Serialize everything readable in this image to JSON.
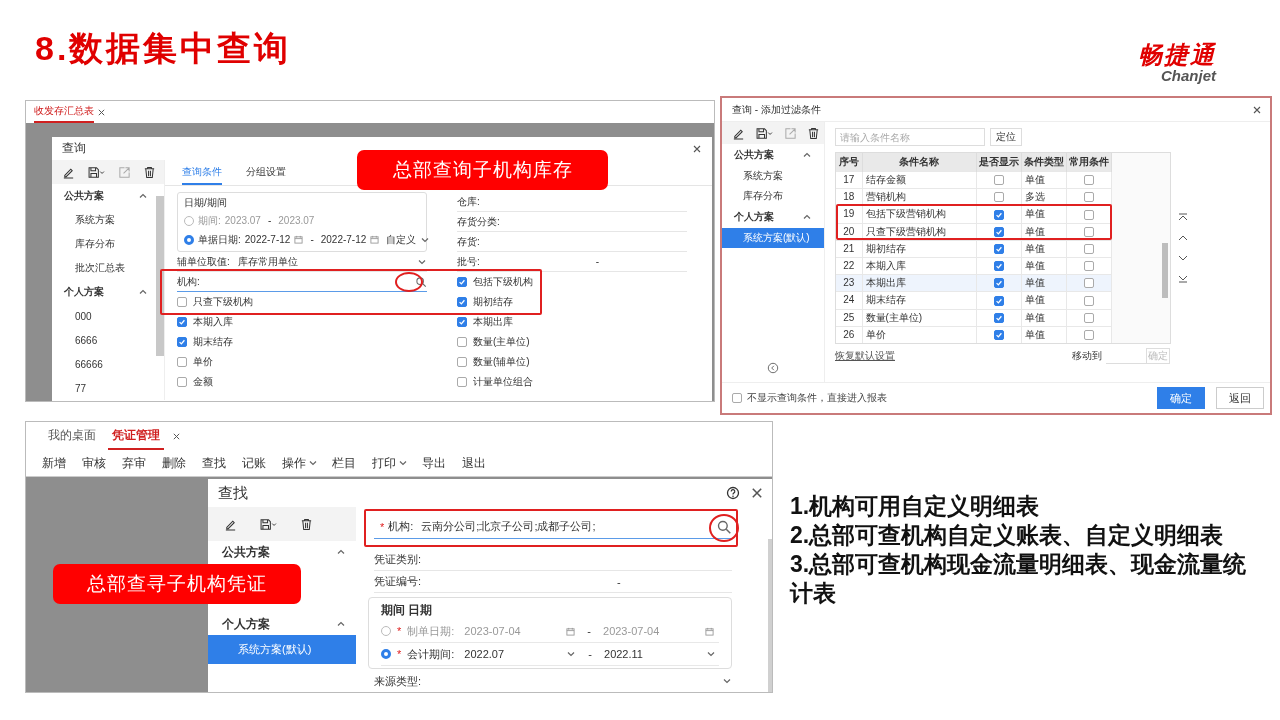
{
  "title": "8.数据集中查询",
  "logo": {
    "name": "畅捷通",
    "sub": "Chanjet"
  },
  "query_window": {
    "tabs": [
      {
        "label": "收发存汇总表",
        "selected": true
      }
    ],
    "dialog_title": "查询",
    "groups": [
      {
        "title": "公共方案",
        "expanded": true,
        "items": [
          {
            "label": "系统方案",
            "selected": false
          },
          {
            "label": "库存分布",
            "selected": false
          },
          {
            "label": "批次汇总表",
            "selected": false
          }
        ]
      },
      {
        "title": "个人方案",
        "expanded": true,
        "items": [
          {
            "label": "000",
            "selected": false
          },
          {
            "label": "6666",
            "selected": false
          },
          {
            "label": "66666",
            "selected": false
          },
          {
            "label": "77",
            "selected": false
          }
        ]
      }
    ],
    "dialog_tabs": [
      {
        "label": "查询条件",
        "selected": true
      },
      {
        "label": "分组设置",
        "selected": false
      }
    ],
    "date_box": {
      "title": "日期/期间",
      "rows": [
        {
          "label": "期间:",
          "from": "2023.07",
          "separator": "-",
          "to": "2023.07",
          "selected": false
        },
        {
          "label": "单据日期:",
          "from": "2022-7-12",
          "separator": "-",
          "to": "2022-7-12",
          "calendar": true,
          "range": "自定义",
          "selected": true
        }
      ]
    },
    "unit": {
      "label": "辅单位取值:",
      "value": "库存常用单位"
    },
    "org": {
      "label": "机构:"
    },
    "left_checks": [
      {
        "label": "只查下级机构",
        "checked": false
      },
      {
        "label": "本期入库",
        "checked": true
      },
      {
        "label": "期末结存",
        "checked": true
      },
      {
        "label": "单价",
        "checked": false
      },
      {
        "label": "金额",
        "checked": false
      }
    ],
    "right_fields": [
      {
        "label": "仓库:"
      },
      {
        "label": "存货分类:"
      },
      {
        "label": "存货:"
      },
      {
        "label": "批号:",
        "separator": "-"
      }
    ],
    "right_checks": [
      {
        "label": "包括下级机构",
        "checked": true
      },
      {
        "label": "期初结存",
        "checked": true
      },
      {
        "label": "本期出库",
        "checked": true
      },
      {
        "label": "数量(主单位)",
        "checked": false
      },
      {
        "label": "数量(辅单位)",
        "checked": false
      },
      {
        "label": "计量单位组合",
        "checked": false
      }
    ],
    "callout": "总部查询子机构库存"
  },
  "filter_dialog": {
    "title": "查询 - 添加过滤条件",
    "groups": [
      {
        "title": "公共方案",
        "expanded": true,
        "items": [
          {
            "label": "系统方案",
            "selected": false
          },
          {
            "label": "库存分布",
            "selected": false
          }
        ]
      },
      {
        "title": "个人方案",
        "expanded": true,
        "items": [
          {
            "label": "系统方案(默认)",
            "selected": true
          }
        ]
      }
    ],
    "search": {
      "placeholder": "请输入条件名称"
    },
    "locate_button": "定位",
    "columns": [
      "序号",
      "条件名称",
      "是否显示",
      "条件类型",
      "常用条件"
    ],
    "rows": [
      {
        "no": "17",
        "name": "结存金额",
        "shown": false,
        "type": "单值",
        "common": false,
        "selected": false
      },
      {
        "no": "18",
        "name": "营销机构",
        "shown": false,
        "type": "多选",
        "common": false,
        "selected": false
      },
      {
        "no": "19",
        "name": "包括下级营销机构",
        "shown": true,
        "type": "单值",
        "common": false,
        "selected": false
      },
      {
        "no": "20",
        "name": "只查下级营销机构",
        "shown": true,
        "type": "单值",
        "common": false,
        "selected": false
      },
      {
        "no": "21",
        "name": "期初结存",
        "shown": true,
        "type": "单值",
        "common": false,
        "selected": false
      },
      {
        "no": "22",
        "name": "本期入库",
        "shown": true,
        "type": "单值",
        "common": false,
        "selected": false
      },
      {
        "no": "23",
        "name": "本期出库",
        "shown": true,
        "type": "单值",
        "common": false,
        "selected": true
      },
      {
        "no": "24",
        "name": "期末结存",
        "shown": true,
        "type": "单值",
        "common": false,
        "selected": false
      },
      {
        "no": "25",
        "name": "数量(主单位)",
        "shown": true,
        "type": "单值",
        "common": false,
        "selected": false
      },
      {
        "no": "26",
        "name": "单价",
        "shown": true,
        "type": "单值",
        "common": false,
        "selected": false
      }
    ],
    "restore_link": "恢复默认设置",
    "move_label": "移动到",
    "move_button": "确定",
    "skip_option": {
      "label": "不显示查询条件，直接进入报表",
      "checked": false
    },
    "ok_button": "确定",
    "back_button": "返回"
  },
  "voucher_window": {
    "tabs": [
      {
        "label": "我的桌面",
        "selected": false
      },
      {
        "label": "凭证管理",
        "selected": true,
        "closable": true
      }
    ],
    "toolbar": [
      {
        "label": "新增"
      },
      {
        "label": "审核"
      },
      {
        "label": "弃审"
      },
      {
        "label": "删除"
      },
      {
        "label": "查找"
      },
      {
        "label": "记账"
      },
      {
        "label": "操作",
        "menu": true
      },
      {
        "label": "栏目"
      },
      {
        "label": "打印",
        "menu": true
      },
      {
        "label": "导出"
      },
      {
        "label": "退出"
      }
    ],
    "dialog_title": "查找",
    "groups": [
      {
        "title": "公共方案",
        "expanded": true
      },
      {
        "title": "个人方案",
        "expanded": true,
        "items": [
          {
            "label": "系统方案(默认)",
            "selected": true
          }
        ]
      }
    ],
    "org": {
      "required_mark": "*",
      "label": "机构:",
      "value": "云南分公司;北京子公司;成都子公司;"
    },
    "fields": [
      {
        "label": "凭证类别:"
      },
      {
        "label": "凭证编号:",
        "separator": "-"
      }
    ],
    "date_box": {
      "title": "期间 日期",
      "rows": [
        {
          "required_mark": "*",
          "label": "制单日期:",
          "from": "2023-07-04",
          "separator": "-",
          "to": "2023-07-04",
          "calendar": true,
          "selected": false
        },
        {
          "required_mark": "*",
          "label": "会计期间:",
          "from": "2022.07",
          "separator": "-",
          "to": "2022.11",
          "dropdown": true,
          "selected": true
        }
      ]
    },
    "source": {
      "label": "来源类型:"
    },
    "callout": "总部查寻子机构凭证"
  },
  "notes": [
    "1.机构可用自定义明细表",
    "2.总部可查机构自定义账表、自定义明细表",
    "3.总部可查机构现金流量明细表、现金流量统计表"
  ]
}
